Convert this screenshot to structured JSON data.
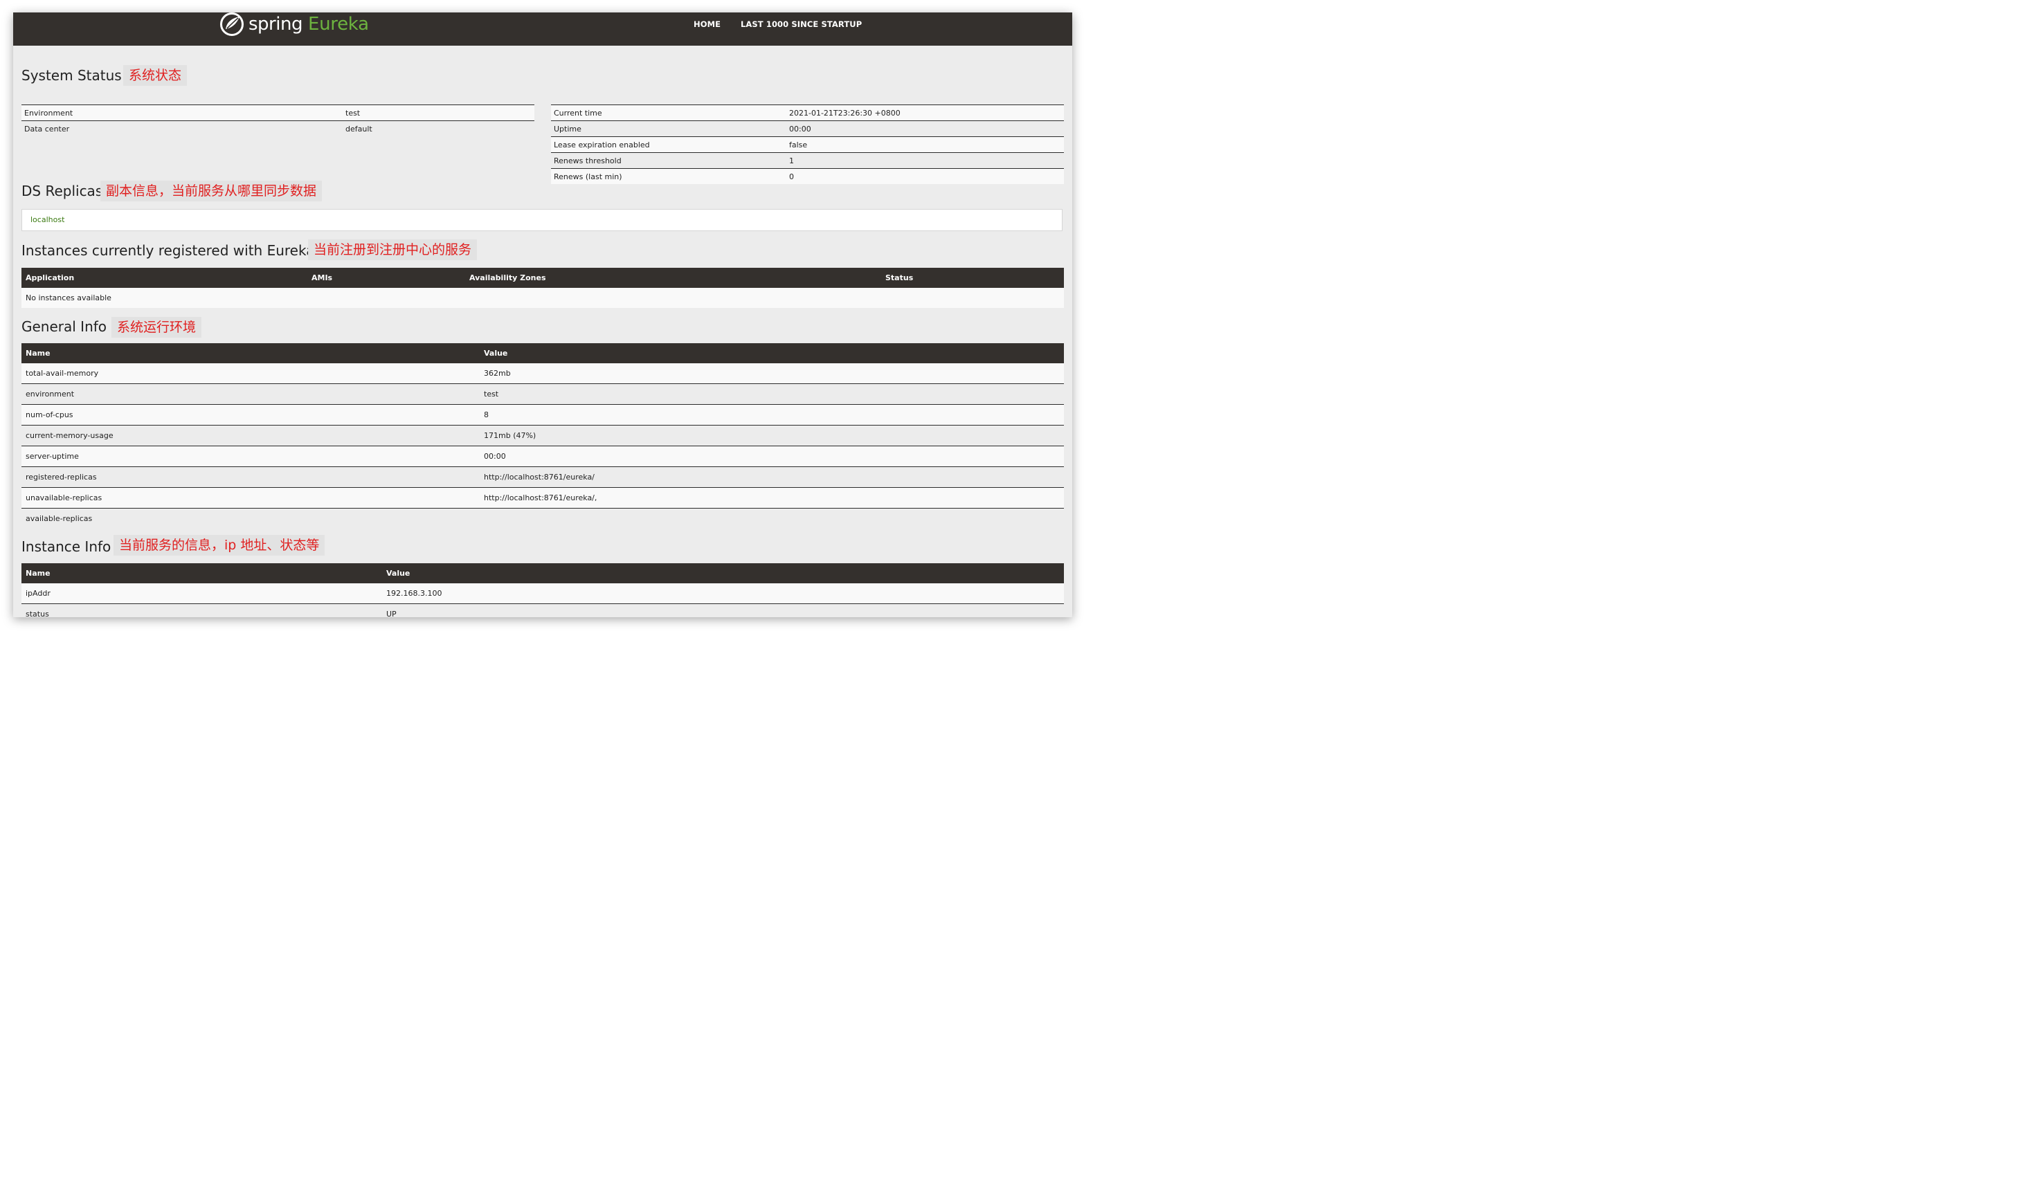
{
  "navbar": {
    "logo_text_spring": "spring",
    "logo_text_eureka": "Eureka",
    "links": [
      "HOME",
      "LAST 1000 SINCE STARTUP"
    ]
  },
  "system_status": {
    "title": "System Status",
    "annotation": "系统状态",
    "left_rows": [
      {
        "name": "Environment",
        "value": "test"
      },
      {
        "name": "Data center",
        "value": "default"
      }
    ],
    "right_rows": [
      {
        "name": "Current time",
        "value": "2021-01-21T23:26:30 +0800"
      },
      {
        "name": "Uptime",
        "value": "00:00"
      },
      {
        "name": "Lease expiration enabled",
        "value": "false"
      },
      {
        "name": "Renews threshold",
        "value": "1"
      },
      {
        "name": "Renews (last min)",
        "value": "0"
      }
    ]
  },
  "ds_replicas": {
    "title": "DS Replicas",
    "annotation": "副本信息，当前服务从哪里同步数据",
    "replica": "localhost"
  },
  "instances": {
    "title": "Instances currently registered with Eureka",
    "annotation": "当前注册到注册中心的服务",
    "headers": [
      "Application",
      "AMIs",
      "Availability Zones",
      "Status"
    ],
    "empty_message": "No instances available"
  },
  "general_info": {
    "title": "General Info",
    "annotation": "系统运行环境",
    "headers": [
      "Name",
      "Value"
    ],
    "rows": [
      {
        "name": "total-avail-memory",
        "value": "362mb"
      },
      {
        "name": "environment",
        "value": "test"
      },
      {
        "name": "num-of-cpus",
        "value": "8"
      },
      {
        "name": "current-memory-usage",
        "value": "171mb (47%)"
      },
      {
        "name": "server-uptime",
        "value": "00:00"
      },
      {
        "name": "registered-replicas",
        "value": "http://localhost:8761/eureka/"
      },
      {
        "name": "unavailable-replicas",
        "value": "http://localhost:8761/eureka/,"
      },
      {
        "name": "available-replicas",
        "value": ""
      }
    ]
  },
  "instance_info": {
    "title": "Instance Info",
    "annotation": "当前服务的信息，ip 地址、状态等",
    "headers": [
      "Name",
      "Value"
    ],
    "rows": [
      {
        "name": "ipAddr",
        "value": "192.168.3.100"
      },
      {
        "name": "status",
        "value": "UP"
      }
    ]
  },
  "colors": {
    "navbar": "#34302d",
    "brand_green": "#6db33f",
    "annotation_red": "#e02020",
    "page_bg": "#ececec"
  }
}
